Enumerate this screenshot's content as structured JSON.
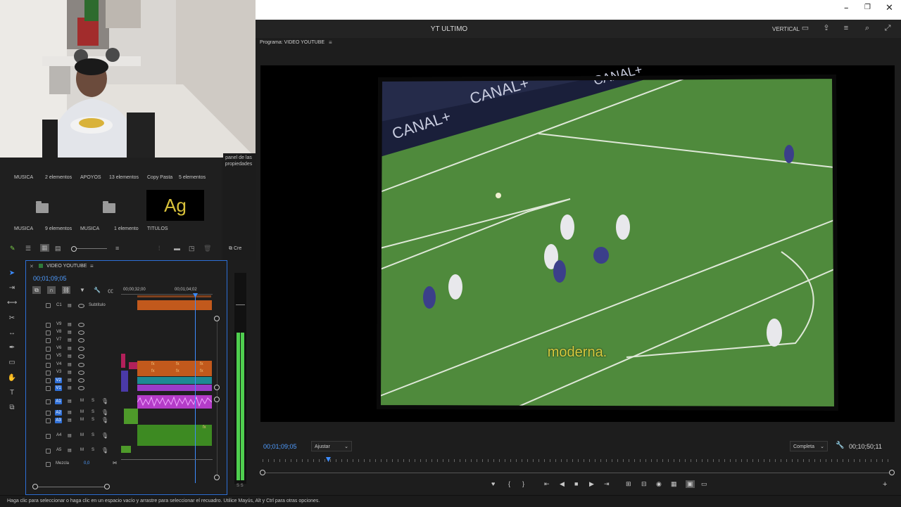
{
  "window": {
    "title": "YT ULTIMO",
    "mode": "VERTICAL"
  },
  "project": {
    "row1": [
      {
        "name": "MUSICA",
        "count": "2 elementos"
      },
      {
        "name": "APOYOS",
        "count": "13 elementos"
      },
      {
        "name": "Copy Pasta",
        "count": "5 elementos"
      }
    ],
    "row2": [
      {
        "name": "MUSICA",
        "count": "9 elementos"
      },
      {
        "name": "MUSICA",
        "count": "1 elemento"
      },
      {
        "name": "TITULOS",
        "count": ""
      }
    ],
    "graphic_text": "Ag",
    "properties_tab": "panel de las propiedades",
    "create_label": "Cre"
  },
  "timeline": {
    "sequence_name": "VIDEO YOUTUBE",
    "timecode": "00;01;09;05",
    "ruler": [
      "00;00;32;00",
      "00;01;04;02"
    ],
    "caption_track": {
      "id": "C1",
      "name": "Subtítulo"
    },
    "video_tracks": [
      "V9",
      "V8",
      "V7",
      "V6",
      "V5",
      "V4",
      "V3",
      "V2",
      "V1"
    ],
    "audio_tracks": [
      "A1",
      "A2",
      "A3",
      "A4",
      "A5"
    ],
    "mix_label": "Mezcla",
    "mix_value": "0,0",
    "meter_label": "S S"
  },
  "program": {
    "title": "Programa: VIDEO YOUTUBE",
    "subtitle_text": "moderna.",
    "timecode": "00;01;09;05",
    "fit": "Ajustar",
    "quality": "Completa",
    "duration": "00;10;50;11",
    "playhead_fraction": 0.104
  },
  "status": {
    "text": "Haga clic para seleccionar o haga clic en un espacio vacío y arrastre para seleccionar el recuadro. Utilice Mayús, Alt y Ctrl para otras opciones."
  },
  "colors": {
    "accent": "#3c8cff",
    "subtitle": "#d8cb3f",
    "pitch": "#4f8a3c",
    "audio_clip": "#4e9a2a",
    "video_clip_purple": "#9b3cc8",
    "video_clip_orange": "#c2591c",
    "video_clip_teal": "#1e8a93"
  }
}
